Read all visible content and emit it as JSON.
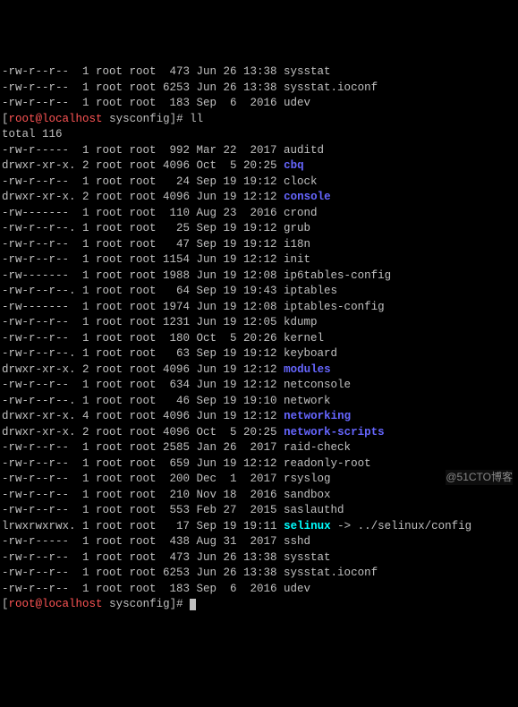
{
  "pre_lines": [
    {
      "perm": "-rw-r--r--",
      "links": "1",
      "owner": "root",
      "group": "root",
      "size": "473",
      "date": "Jun 26 13:38",
      "name": "sysstat"
    },
    {
      "perm": "-rw-r--r--",
      "links": "1",
      "owner": "root",
      "group": "root",
      "size": "6253",
      "date": "Jun 26 13:38",
      "name": "sysstat.ioconf"
    },
    {
      "perm": "-rw-r--r--",
      "links": "1",
      "owner": "root",
      "group": "root",
      "size": "183",
      "date": "Sep  6  2016",
      "name": "udev"
    }
  ],
  "prompt": {
    "user": "root",
    "host": "localhost",
    "path": "sysconfig",
    "command": "ll"
  },
  "total_label": "total 116",
  "listing": [
    {
      "perm": "-rw-r-----",
      "links": "1",
      "owner": "root",
      "group": "root",
      "size": "992",
      "date": "Mar 22  2017",
      "name": "auditd",
      "type": "file"
    },
    {
      "perm": "drwxr-xr-x.",
      "links": "2",
      "owner": "root",
      "group": "root",
      "size": "4096",
      "date": "Oct  5 20:25",
      "name": "cbq",
      "type": "dir"
    },
    {
      "perm": "-rw-r--r--",
      "links": "1",
      "owner": "root",
      "group": "root",
      "size": "24",
      "date": "Sep 19 19:12",
      "name": "clock",
      "type": "file"
    },
    {
      "perm": "drwxr-xr-x.",
      "links": "2",
      "owner": "root",
      "group": "root",
      "size": "4096",
      "date": "Jun 19 12:12",
      "name": "console",
      "type": "dir"
    },
    {
      "perm": "-rw-------",
      "links": "1",
      "owner": "root",
      "group": "root",
      "size": "110",
      "date": "Aug 23  2016",
      "name": "crond",
      "type": "file"
    },
    {
      "perm": "-rw-r--r--.",
      "links": "1",
      "owner": "root",
      "group": "root",
      "size": "25",
      "date": "Sep 19 19:12",
      "name": "grub",
      "type": "file"
    },
    {
      "perm": "-rw-r--r--",
      "links": "1",
      "owner": "root",
      "group": "root",
      "size": "47",
      "date": "Sep 19 19:12",
      "name": "i18n",
      "type": "file"
    },
    {
      "perm": "-rw-r--r--",
      "links": "1",
      "owner": "root",
      "group": "root",
      "size": "1154",
      "date": "Jun 19 12:12",
      "name": "init",
      "type": "file"
    },
    {
      "perm": "-rw-------",
      "links": "1",
      "owner": "root",
      "group": "root",
      "size": "1988",
      "date": "Jun 19 12:08",
      "name": "ip6tables-config",
      "type": "file"
    },
    {
      "perm": "-rw-r--r--.",
      "links": "1",
      "owner": "root",
      "group": "root",
      "size": "64",
      "date": "Sep 19 19:43",
      "name": "iptables",
      "type": "file"
    },
    {
      "perm": "-rw-------",
      "links": "1",
      "owner": "root",
      "group": "root",
      "size": "1974",
      "date": "Jun 19 12:08",
      "name": "iptables-config",
      "type": "file"
    },
    {
      "perm": "-rw-r--r--",
      "links": "1",
      "owner": "root",
      "group": "root",
      "size": "1231",
      "date": "Jun 19 12:05",
      "name": "kdump",
      "type": "file"
    },
    {
      "perm": "-rw-r--r--",
      "links": "1",
      "owner": "root",
      "group": "root",
      "size": "180",
      "date": "Oct  5 20:26",
      "name": "kernel",
      "type": "file"
    },
    {
      "perm": "-rw-r--r--.",
      "links": "1",
      "owner": "root",
      "group": "root",
      "size": "63",
      "date": "Sep 19 19:12",
      "name": "keyboard",
      "type": "file"
    },
    {
      "perm": "drwxr-xr-x.",
      "links": "2",
      "owner": "root",
      "group": "root",
      "size": "4096",
      "date": "Jun 19 12:12",
      "name": "modules",
      "type": "dir"
    },
    {
      "perm": "-rw-r--r--",
      "links": "1",
      "owner": "root",
      "group": "root",
      "size": "634",
      "date": "Jun 19 12:12",
      "name": "netconsole",
      "type": "file"
    },
    {
      "perm": "-rw-r--r--.",
      "links": "1",
      "owner": "root",
      "group": "root",
      "size": "46",
      "date": "Sep 19 19:10",
      "name": "network",
      "type": "file"
    },
    {
      "perm": "drwxr-xr-x.",
      "links": "4",
      "owner": "root",
      "group": "root",
      "size": "4096",
      "date": "Jun 19 12:12",
      "name": "networking",
      "type": "dir"
    },
    {
      "perm": "drwxr-xr-x.",
      "links": "2",
      "owner": "root",
      "group": "root",
      "size": "4096",
      "date": "Oct  5 20:25",
      "name": "network-scripts",
      "type": "dir"
    },
    {
      "perm": "-rw-r--r--",
      "links": "1",
      "owner": "root",
      "group": "root",
      "size": "2585",
      "date": "Jan 26  2017",
      "name": "raid-check",
      "type": "file"
    },
    {
      "perm": "-rw-r--r--",
      "links": "1",
      "owner": "root",
      "group": "root",
      "size": "659",
      "date": "Jun 19 12:12",
      "name": "readonly-root",
      "type": "file"
    },
    {
      "perm": "-rw-r--r--",
      "links": "1",
      "owner": "root",
      "group": "root",
      "size": "200",
      "date": "Dec  1  2017",
      "name": "rsyslog",
      "type": "file"
    },
    {
      "perm": "-rw-r--r--",
      "links": "1",
      "owner": "root",
      "group": "root",
      "size": "210",
      "date": "Nov 18  2016",
      "name": "sandbox",
      "type": "file"
    },
    {
      "perm": "-rw-r--r--",
      "links": "1",
      "owner": "root",
      "group": "root",
      "size": "553",
      "date": "Feb 27  2015",
      "name": "saslauthd",
      "type": "file"
    },
    {
      "perm": "lrwxrwxrwx.",
      "links": "1",
      "owner": "root",
      "group": "root",
      "size": "17",
      "date": "Sep 19 19:11",
      "name": "selinux",
      "type": "link",
      "target": "../selinux/config"
    },
    {
      "perm": "-rw-r-----",
      "links": "1",
      "owner": "root",
      "group": "root",
      "size": "438",
      "date": "Aug 31  2017",
      "name": "sshd",
      "type": "file"
    },
    {
      "perm": "-rw-r--r--",
      "links": "1",
      "owner": "root",
      "group": "root",
      "size": "473",
      "date": "Jun 26 13:38",
      "name": "sysstat",
      "type": "file"
    },
    {
      "perm": "-rw-r--r--",
      "links": "1",
      "owner": "root",
      "group": "root",
      "size": "6253",
      "date": "Jun 26 13:38",
      "name": "sysstat.ioconf",
      "type": "file"
    },
    {
      "perm": "-rw-r--r--",
      "links": "1",
      "owner": "root",
      "group": "root",
      "size": "183",
      "date": "Sep  6  2016",
      "name": "udev",
      "type": "file"
    }
  ],
  "prompt2": {
    "user": "root",
    "host": "localhost",
    "path": "sysconfig"
  },
  "watermark": "@51CTO博客"
}
